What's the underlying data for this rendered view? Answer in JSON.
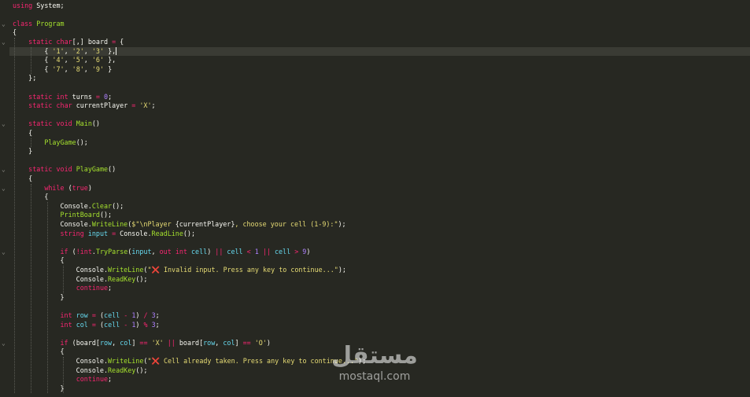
{
  "editor": {
    "lines": [
      {
        "tokens": [
          [
            "kw",
            "using"
          ],
          [
            "pl",
            " System;"
          ]
        ]
      },
      {
        "tokens": []
      },
      {
        "fold": true,
        "tokens": [
          [
            "kw",
            "class"
          ],
          [
            "pl",
            " "
          ],
          [
            "cls",
            "Program"
          ]
        ]
      },
      {
        "tokens": [
          [
            "pl",
            "{"
          ]
        ]
      },
      {
        "fold": true,
        "tokens": [
          [
            "pl",
            "    "
          ],
          [
            "kw",
            "static"
          ],
          [
            "pl",
            " "
          ],
          [
            "kw",
            "char"
          ],
          [
            "pl",
            "[,] board "
          ],
          [
            "op",
            "="
          ],
          [
            "pl",
            " {"
          ]
        ]
      },
      {
        "current": true,
        "tokens": [
          [
            "pl",
            "        { "
          ],
          [
            "str",
            "'1'"
          ],
          [
            "pl",
            ", "
          ],
          [
            "str",
            "'2'"
          ],
          [
            "pl",
            ", "
          ],
          [
            "str",
            "'3'"
          ],
          [
            "pl",
            " },"
          ]
        ]
      },
      {
        "tokens": [
          [
            "pl",
            "        { "
          ],
          [
            "str",
            "'4'"
          ],
          [
            "pl",
            ", "
          ],
          [
            "str",
            "'5'"
          ],
          [
            "pl",
            ", "
          ],
          [
            "str",
            "'6'"
          ],
          [
            "pl",
            " },"
          ]
        ]
      },
      {
        "tokens": [
          [
            "pl",
            "        { "
          ],
          [
            "str",
            "'7'"
          ],
          [
            "pl",
            ", "
          ],
          [
            "str",
            "'8'"
          ],
          [
            "pl",
            ", "
          ],
          [
            "str",
            "'9'"
          ],
          [
            "pl",
            " }"
          ]
        ]
      },
      {
        "tokens": [
          [
            "pl",
            "    };"
          ]
        ]
      },
      {
        "tokens": []
      },
      {
        "tokens": [
          [
            "pl",
            "    "
          ],
          [
            "kw",
            "static"
          ],
          [
            "pl",
            " "
          ],
          [
            "kw",
            "int"
          ],
          [
            "pl",
            " turns "
          ],
          [
            "op",
            "="
          ],
          [
            "pl",
            " "
          ],
          [
            "num",
            "0"
          ],
          [
            "pl",
            ";"
          ]
        ]
      },
      {
        "tokens": [
          [
            "pl",
            "    "
          ],
          [
            "kw",
            "static"
          ],
          [
            "pl",
            " "
          ],
          [
            "kw",
            "char"
          ],
          [
            "pl",
            " currentPlayer "
          ],
          [
            "op",
            "="
          ],
          [
            "pl",
            " "
          ],
          [
            "str",
            "'X'"
          ],
          [
            "pl",
            ";"
          ]
        ]
      },
      {
        "tokens": []
      },
      {
        "fold": true,
        "tokens": [
          [
            "pl",
            "    "
          ],
          [
            "kw",
            "static"
          ],
          [
            "pl",
            " "
          ],
          [
            "kw",
            "void"
          ],
          [
            "pl",
            " "
          ],
          [
            "fn",
            "Main"
          ],
          [
            "pl",
            "()"
          ]
        ]
      },
      {
        "tokens": [
          [
            "pl",
            "    {"
          ]
        ]
      },
      {
        "tokens": [
          [
            "pl",
            "        "
          ],
          [
            "fn",
            "PlayGame"
          ],
          [
            "pl",
            "();"
          ]
        ]
      },
      {
        "tokens": [
          [
            "pl",
            "    }"
          ]
        ]
      },
      {
        "tokens": []
      },
      {
        "fold": true,
        "tokens": [
          [
            "pl",
            "    "
          ],
          [
            "kw",
            "static"
          ],
          [
            "pl",
            " "
          ],
          [
            "kw",
            "void"
          ],
          [
            "pl",
            " "
          ],
          [
            "fn",
            "PlayGame"
          ],
          [
            "pl",
            "()"
          ]
        ]
      },
      {
        "tokens": [
          [
            "pl",
            "    {"
          ]
        ]
      },
      {
        "fold": true,
        "tokens": [
          [
            "pl",
            "        "
          ],
          [
            "kw",
            "while"
          ],
          [
            "pl",
            " ("
          ],
          [
            "kw",
            "true"
          ],
          [
            "pl",
            ")"
          ]
        ]
      },
      {
        "tokens": [
          [
            "pl",
            "        {"
          ]
        ]
      },
      {
        "tokens": [
          [
            "pl",
            "            Console."
          ],
          [
            "fn",
            "Clear"
          ],
          [
            "pl",
            "();"
          ]
        ]
      },
      {
        "tokens": [
          [
            "pl",
            "            "
          ],
          [
            "fn",
            "PrintBoard"
          ],
          [
            "pl",
            "();"
          ]
        ]
      },
      {
        "tokens": [
          [
            "pl",
            "            Console."
          ],
          [
            "fn",
            "WriteLine"
          ],
          [
            "pl",
            "("
          ],
          [
            "str",
            "$\"\\nPlayer "
          ],
          [
            "pl",
            "{currentPlayer}"
          ],
          [
            "str",
            ", choose your cell (1-9):\""
          ],
          [
            "pl",
            ");"
          ]
        ]
      },
      {
        "tokens": [
          [
            "pl",
            "            "
          ],
          [
            "kw",
            "string"
          ],
          [
            "pl",
            " "
          ],
          [
            "tp",
            "input"
          ],
          [
            "pl",
            " "
          ],
          [
            "op",
            "="
          ],
          [
            "pl",
            " Console."
          ],
          [
            "fn",
            "ReadLine"
          ],
          [
            "pl",
            "();"
          ]
        ]
      },
      {
        "tokens": []
      },
      {
        "fold": true,
        "tokens": [
          [
            "pl",
            "            "
          ],
          [
            "kw",
            "if"
          ],
          [
            "pl",
            " ("
          ],
          [
            "op",
            "!"
          ],
          [
            "kw",
            "int"
          ],
          [
            "pl",
            "."
          ],
          [
            "fn",
            "TryParse"
          ],
          [
            "pl",
            "("
          ],
          [
            "tp",
            "input"
          ],
          [
            "pl",
            ", "
          ],
          [
            "kw",
            "out"
          ],
          [
            "pl",
            " "
          ],
          [
            "kw",
            "int"
          ],
          [
            "pl",
            " "
          ],
          [
            "tp",
            "cell"
          ],
          [
            "pl",
            ") "
          ],
          [
            "op",
            "||"
          ],
          [
            "pl",
            " "
          ],
          [
            "tp",
            "cell"
          ],
          [
            "pl",
            " "
          ],
          [
            "op",
            "<"
          ],
          [
            "pl",
            " "
          ],
          [
            "num",
            "1"
          ],
          [
            "pl",
            " "
          ],
          [
            "op",
            "||"
          ],
          [
            "pl",
            " "
          ],
          [
            "tp",
            "cell"
          ],
          [
            "pl",
            " "
          ],
          [
            "op",
            ">"
          ],
          [
            "pl",
            " "
          ],
          [
            "num",
            "9"
          ],
          [
            "pl",
            ")"
          ]
        ]
      },
      {
        "tokens": [
          [
            "pl",
            "            {"
          ]
        ]
      },
      {
        "tokens": [
          [
            "pl",
            "                Console."
          ],
          [
            "fn",
            "WriteLine"
          ],
          [
            "pl",
            "("
          ],
          [
            "str",
            "\"❌ Invalid input. Press any key to continue...\""
          ],
          [
            "pl",
            ");"
          ]
        ]
      },
      {
        "tokens": [
          [
            "pl",
            "                Console."
          ],
          [
            "fn",
            "ReadKey"
          ],
          [
            "pl",
            "();"
          ]
        ]
      },
      {
        "tokens": [
          [
            "pl",
            "                "
          ],
          [
            "kw",
            "continue"
          ],
          [
            "pl",
            ";"
          ]
        ]
      },
      {
        "tokens": [
          [
            "pl",
            "            }"
          ]
        ]
      },
      {
        "tokens": []
      },
      {
        "tokens": [
          [
            "pl",
            "            "
          ],
          [
            "kw",
            "int"
          ],
          [
            "pl",
            " "
          ],
          [
            "tp",
            "row"
          ],
          [
            "pl",
            " "
          ],
          [
            "op",
            "="
          ],
          [
            "pl",
            " ("
          ],
          [
            "tp",
            "cell"
          ],
          [
            "pl",
            " "
          ],
          [
            "op",
            "-"
          ],
          [
            "pl",
            " "
          ],
          [
            "num",
            "1"
          ],
          [
            "pl",
            ") "
          ],
          [
            "op",
            "/"
          ],
          [
            "pl",
            " "
          ],
          [
            "num",
            "3"
          ],
          [
            "pl",
            ";"
          ]
        ]
      },
      {
        "tokens": [
          [
            "pl",
            "            "
          ],
          [
            "kw",
            "int"
          ],
          [
            "pl",
            " "
          ],
          [
            "tp",
            "col"
          ],
          [
            "pl",
            " "
          ],
          [
            "op",
            "="
          ],
          [
            "pl",
            " ("
          ],
          [
            "tp",
            "cell"
          ],
          [
            "pl",
            " "
          ],
          [
            "op",
            "-"
          ],
          [
            "pl",
            " "
          ],
          [
            "num",
            "1"
          ],
          [
            "pl",
            ") "
          ],
          [
            "op",
            "%"
          ],
          [
            "pl",
            " "
          ],
          [
            "num",
            "3"
          ],
          [
            "pl",
            ";"
          ]
        ]
      },
      {
        "tokens": []
      },
      {
        "fold": true,
        "tokens": [
          [
            "pl",
            "            "
          ],
          [
            "kw",
            "if"
          ],
          [
            "pl",
            " (board["
          ],
          [
            "tp",
            "row"
          ],
          [
            "pl",
            ", "
          ],
          [
            "tp",
            "col"
          ],
          [
            "pl",
            "] "
          ],
          [
            "op",
            "=="
          ],
          [
            "pl",
            " "
          ],
          [
            "str",
            "'X'"
          ],
          [
            "pl",
            " "
          ],
          [
            "op",
            "||"
          ],
          [
            "pl",
            " board["
          ],
          [
            "tp",
            "row"
          ],
          [
            "pl",
            ", "
          ],
          [
            "tp",
            "col"
          ],
          [
            "pl",
            "] "
          ],
          [
            "op",
            "=="
          ],
          [
            "pl",
            " "
          ],
          [
            "str",
            "'O'"
          ],
          [
            "pl",
            ")"
          ]
        ]
      },
      {
        "tokens": [
          [
            "pl",
            "            {"
          ]
        ]
      },
      {
        "tokens": [
          [
            "pl",
            "                Console."
          ],
          [
            "fn",
            "WriteLine"
          ],
          [
            "pl",
            "("
          ],
          [
            "str",
            "\"❌ Cell already taken. Press any key to continue...\""
          ],
          [
            "pl",
            ");"
          ]
        ]
      },
      {
        "tokens": [
          [
            "pl",
            "                Console."
          ],
          [
            "fn",
            "ReadKey"
          ],
          [
            "pl",
            "();"
          ]
        ]
      },
      {
        "tokens": [
          [
            "pl",
            "                "
          ],
          [
            "kw",
            "continue"
          ],
          [
            "pl",
            ";"
          ]
        ]
      },
      {
        "tokens": [
          [
            "pl",
            "            }"
          ]
        ]
      }
    ]
  },
  "watermark": {
    "arabic": "مستقل",
    "latin": "mostaql.com"
  },
  "colors": {
    "background": "#272822",
    "keyword": "#f92672",
    "function": "#a6e22e",
    "string": "#e6db74",
    "number": "#ae81ff",
    "variable": "#66d9ef",
    "text": "#f8f8f2"
  },
  "icons": {
    "fold": "chevron-down-icon",
    "error_emoji": "cross-mark-icon"
  }
}
